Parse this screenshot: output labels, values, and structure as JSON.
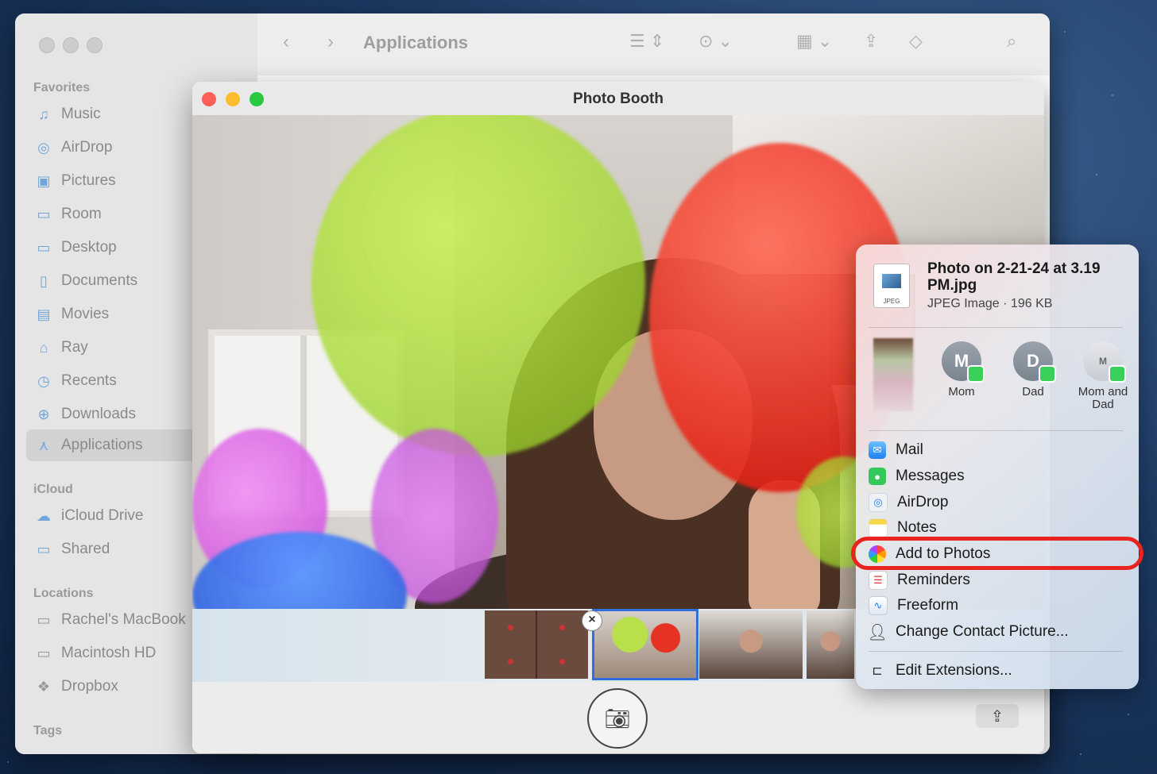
{
  "finder": {
    "toolbar_title": "Applications",
    "sections": {
      "favorites": "Favorites",
      "icloud": "iCloud",
      "locations": "Locations",
      "tags": "Tags"
    },
    "favorites": [
      {
        "label": "Music",
        "icon": "music-icon"
      },
      {
        "label": "AirDrop",
        "icon": "airdrop-icon"
      },
      {
        "label": "Pictures",
        "icon": "pictures-icon"
      },
      {
        "label": "Room",
        "icon": "folder-icon"
      },
      {
        "label": "Desktop",
        "icon": "desktop-icon"
      },
      {
        "label": "Documents",
        "icon": "document-icon"
      },
      {
        "label": "Movies",
        "icon": "movies-icon"
      },
      {
        "label": "Ray",
        "icon": "home-icon"
      },
      {
        "label": "Recents",
        "icon": "clock-icon"
      },
      {
        "label": "Downloads",
        "icon": "download-icon"
      },
      {
        "label": "Applications",
        "icon": "applications-icon"
      }
    ],
    "icloud": [
      {
        "label": "iCloud Drive",
        "icon": "cloud-icon"
      },
      {
        "label": "Shared",
        "icon": "shared-folder-icon"
      }
    ],
    "locations": [
      {
        "label": "Rachel's MacBook",
        "icon": "laptop-icon"
      },
      {
        "label": "Macintosh HD",
        "icon": "disk-icon"
      },
      {
        "label": "Dropbox",
        "icon": "dropbox-icon"
      }
    ]
  },
  "photobooth": {
    "title": "Photo Booth"
  },
  "share": {
    "file_name": "Photo on 2-21-24 at 3.19 PM.jpg",
    "file_meta": "JPEG Image · 196 KB",
    "file_icon_label": "JPEG",
    "contacts": [
      {
        "initial": "M",
        "name": "Mom"
      },
      {
        "initial": "D",
        "name": "Dad"
      },
      {
        "initial": "M",
        "name": "Mom and Dad"
      }
    ],
    "items": [
      {
        "label": "Mail",
        "icon": "mail-icon"
      },
      {
        "label": "Messages",
        "icon": "messages-icon"
      },
      {
        "label": "AirDrop",
        "icon": "airdrop-icon"
      },
      {
        "label": "Notes",
        "icon": "notes-icon"
      },
      {
        "label": "Add to Photos",
        "icon": "photos-icon"
      },
      {
        "label": "Reminders",
        "icon": "reminders-icon"
      },
      {
        "label": "Freeform",
        "icon": "freeform-icon"
      },
      {
        "label": "Change Contact Picture...",
        "icon": "person-icon"
      }
    ],
    "edit_extensions": "Edit Extensions...",
    "highlight_color": "#e8241f"
  }
}
